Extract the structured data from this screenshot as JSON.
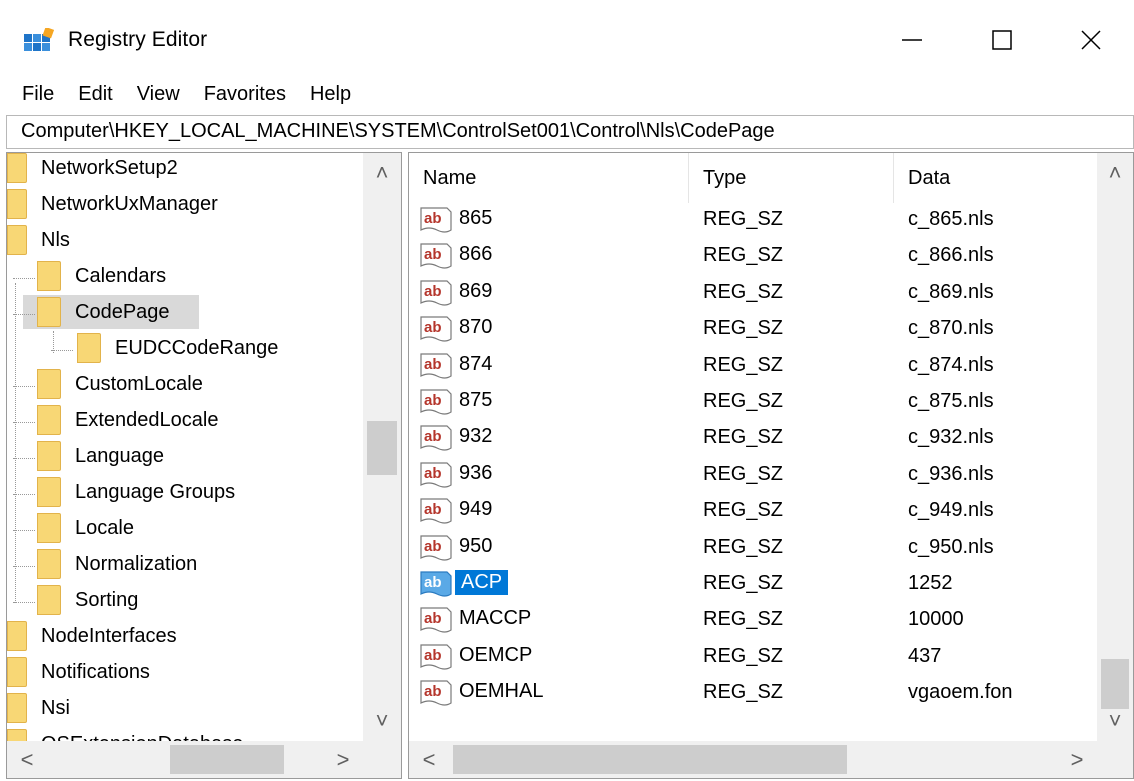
{
  "window": {
    "title": "Registry Editor",
    "app_icon": "registry-editor-icon",
    "controls": {
      "minimize": "minimize-icon",
      "maximize": "maximize-icon",
      "close": "close-icon"
    }
  },
  "menu": {
    "items": [
      {
        "label": "File"
      },
      {
        "label": "Edit"
      },
      {
        "label": "View"
      },
      {
        "label": "Favorites"
      },
      {
        "label": "Help"
      }
    ]
  },
  "address": {
    "path": "Computer\\HKEY_LOCAL_MACHINE\\SYSTEM\\ControlSet001\\Control\\Nls\\CodePage"
  },
  "tree": {
    "items": [
      {
        "label": "NetworkSetup2"
      },
      {
        "label": "NetworkUxManager"
      },
      {
        "label": "Nls"
      },
      {
        "label": "Calendars"
      },
      {
        "label": "CodePage",
        "selected": true
      },
      {
        "label": "EUDCCodeRange"
      },
      {
        "label": "CustomLocale"
      },
      {
        "label": "ExtendedLocale"
      },
      {
        "label": "Language"
      },
      {
        "label": "Language Groups"
      },
      {
        "label": "Locale"
      },
      {
        "label": "Normalization"
      },
      {
        "label": "Sorting"
      },
      {
        "label": "NodeInterfaces"
      },
      {
        "label": "Notifications"
      },
      {
        "label": "Nsi"
      },
      {
        "label": "OSExtensionDatabase"
      }
    ],
    "scroll_up": "^",
    "scroll_down": "v",
    "scroll_left": "<",
    "scroll_right": ">"
  },
  "values": {
    "columns": {
      "name": "Name",
      "type": "Type",
      "data": "Data"
    },
    "rows": [
      {
        "name": "865",
        "type": "REG_SZ",
        "data": "c_865.nls"
      },
      {
        "name": "866",
        "type": "REG_SZ",
        "data": "c_866.nls"
      },
      {
        "name": "869",
        "type": "REG_SZ",
        "data": "c_869.nls"
      },
      {
        "name": "870",
        "type": "REG_SZ",
        "data": "c_870.nls"
      },
      {
        "name": "874",
        "type": "REG_SZ",
        "data": "c_874.nls"
      },
      {
        "name": "875",
        "type": "REG_SZ",
        "data": "c_875.nls"
      },
      {
        "name": "932",
        "type": "REG_SZ",
        "data": "c_932.nls"
      },
      {
        "name": "936",
        "type": "REG_SZ",
        "data": "c_936.nls"
      },
      {
        "name": "949",
        "type": "REG_SZ",
        "data": "c_949.nls"
      },
      {
        "name": "950",
        "type": "REG_SZ",
        "data": "c_950.nls"
      },
      {
        "name": "ACP",
        "type": "REG_SZ",
        "data": "1252",
        "selected": true
      },
      {
        "name": "MACCP",
        "type": "REG_SZ",
        "data": "10000"
      },
      {
        "name": "OEMCP",
        "type": "REG_SZ",
        "data": "437"
      },
      {
        "name": "OEMHAL",
        "type": "REG_SZ",
        "data": "vgaoem.fon"
      }
    ],
    "value_icon": "string-value-icon",
    "selection_color": "#0078d7"
  }
}
